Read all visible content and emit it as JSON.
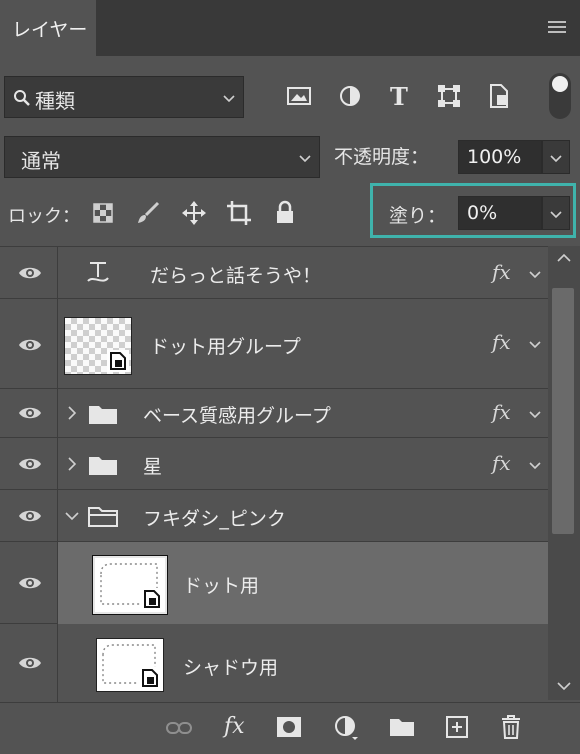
{
  "panel": {
    "tab_label": "レイヤー",
    "menu_icon": "hamburger-menu-icon"
  },
  "filter": {
    "label": "種類",
    "icons": [
      "image-filter-icon",
      "adjustment-filter-icon",
      "type-filter-icon",
      "shape-filter-icon",
      "smartobject-filter-icon"
    ]
  },
  "blend": {
    "mode": "通常",
    "opacity_label": "不透明度：",
    "opacity_value": "100%"
  },
  "lock": {
    "label": "ロック：",
    "fill_label": "塗り：",
    "fill_value": "0%"
  },
  "layers": [
    {
      "name": "だらっと話そうや！",
      "type": "text",
      "fx": "fx"
    },
    {
      "name": "ドット用グループ",
      "type": "smart-object",
      "fx": "fx"
    },
    {
      "name": "ベース質感用グループ",
      "type": "group",
      "fx": "fx"
    },
    {
      "name": "星",
      "type": "group",
      "fx": "fx"
    },
    {
      "name": "フキダシ_ピンク",
      "type": "group-open",
      "fx": ""
    },
    {
      "name": "ドット用",
      "type": "smart-object",
      "fx": "",
      "selected": true
    },
    {
      "name": "シャドウ用",
      "type": "smart-object",
      "fx": ""
    }
  ],
  "footer": {
    "icons": [
      "link-icon",
      "fx-icon",
      "mask-icon",
      "adjustment-icon",
      "new-group-icon",
      "new-layer-icon",
      "trash-icon"
    ]
  },
  "colors": {
    "highlight": "#3fb3ac",
    "panel_bg": "#535353",
    "selected_row": "#6b6b6b"
  }
}
